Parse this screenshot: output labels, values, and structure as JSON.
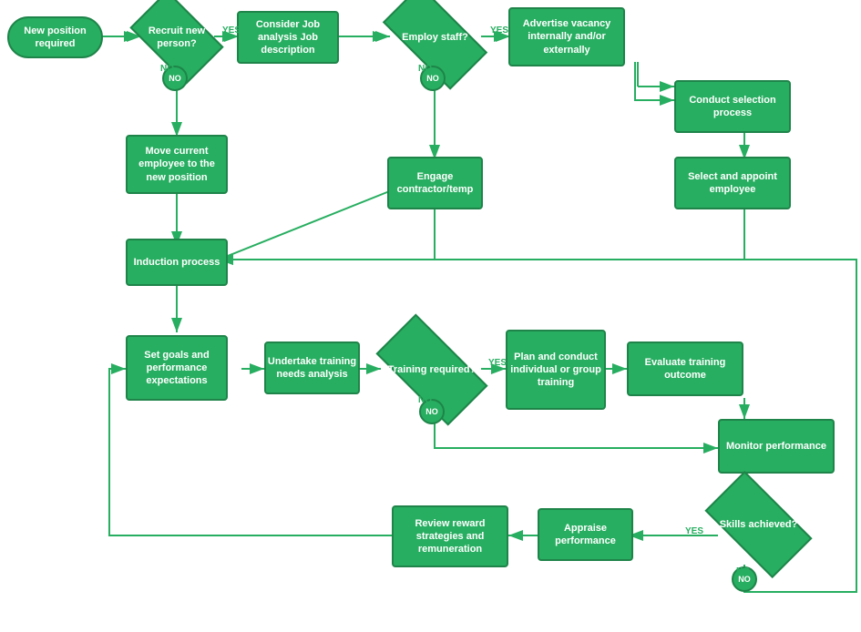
{
  "nodes": {
    "new_position": {
      "label": "New position required"
    },
    "recruit": {
      "label": "Recruit new person?"
    },
    "consider": {
      "label": "Consider Job analysis Job description"
    },
    "employ": {
      "label": "Employ staff?"
    },
    "advertise": {
      "label": "Advertise vacancy internally and/or externally"
    },
    "conduct_selection": {
      "label": "Conduct selection process"
    },
    "select_appoint": {
      "label": "Select and appoint employee"
    },
    "move_employee": {
      "label": "Move current employee to the new position"
    },
    "engage_contractor": {
      "label": "Engage contractor/temp"
    },
    "induction": {
      "label": "Induction process"
    },
    "set_goals": {
      "label": "Set goals and performance expectations"
    },
    "training_needs": {
      "label": "Undertake training needs analysis"
    },
    "training_required": {
      "label": "Training required?"
    },
    "plan_training": {
      "label": "Plan and conduct individual or group training"
    },
    "evaluate_training": {
      "label": "Evaluate training outcome"
    },
    "monitor_performance": {
      "label": "Monitor performance"
    },
    "skills_achieved": {
      "label": "Skills achieved?"
    },
    "appraise": {
      "label": "Appraise performance"
    },
    "review_reward": {
      "label": "Review reward strategies and remuneration"
    },
    "yes1": {
      "label": "YES"
    },
    "no1": {
      "label": "NO"
    },
    "yes2": {
      "label": "YES"
    },
    "no2": {
      "label": "NO"
    },
    "yes3": {
      "label": "YES"
    },
    "no3": {
      "label": "NO"
    },
    "yes4": {
      "label": "YES"
    },
    "no4": {
      "label": "NO"
    }
  },
  "colors": {
    "green": "#27ae60",
    "green_dark": "#1e8449"
  }
}
